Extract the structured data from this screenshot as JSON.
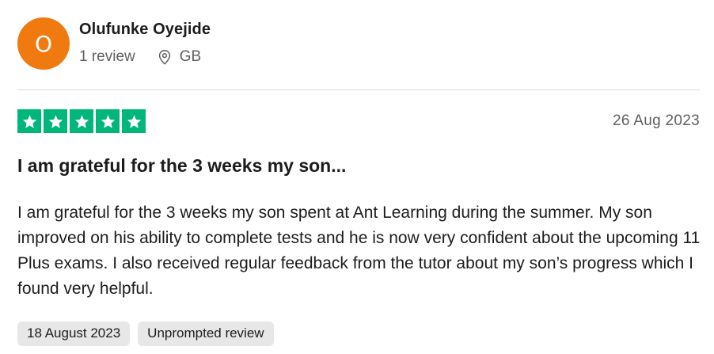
{
  "reviewer": {
    "initial": "O",
    "name": "Olufunke Oyejide",
    "review_count": "1 review",
    "country": "GB",
    "avatar_color": "#f07a10"
  },
  "rating": {
    "stars": 5,
    "max": 5,
    "star_color": "#00b67a"
  },
  "review": {
    "date": "26 Aug 2023",
    "title": "I am grateful for the 3 weeks my son...",
    "body": "I am grateful for the 3 weeks my son spent at Ant Learning during the summer. My son improved on his ability to complete tests and he is now very confident about the upcoming 11 Plus exams. I also received regular feedback from the tutor about my son’s progress which I found very helpful."
  },
  "tags": {
    "experience_date": "18 August 2023",
    "review_type": "Unprompted review"
  }
}
